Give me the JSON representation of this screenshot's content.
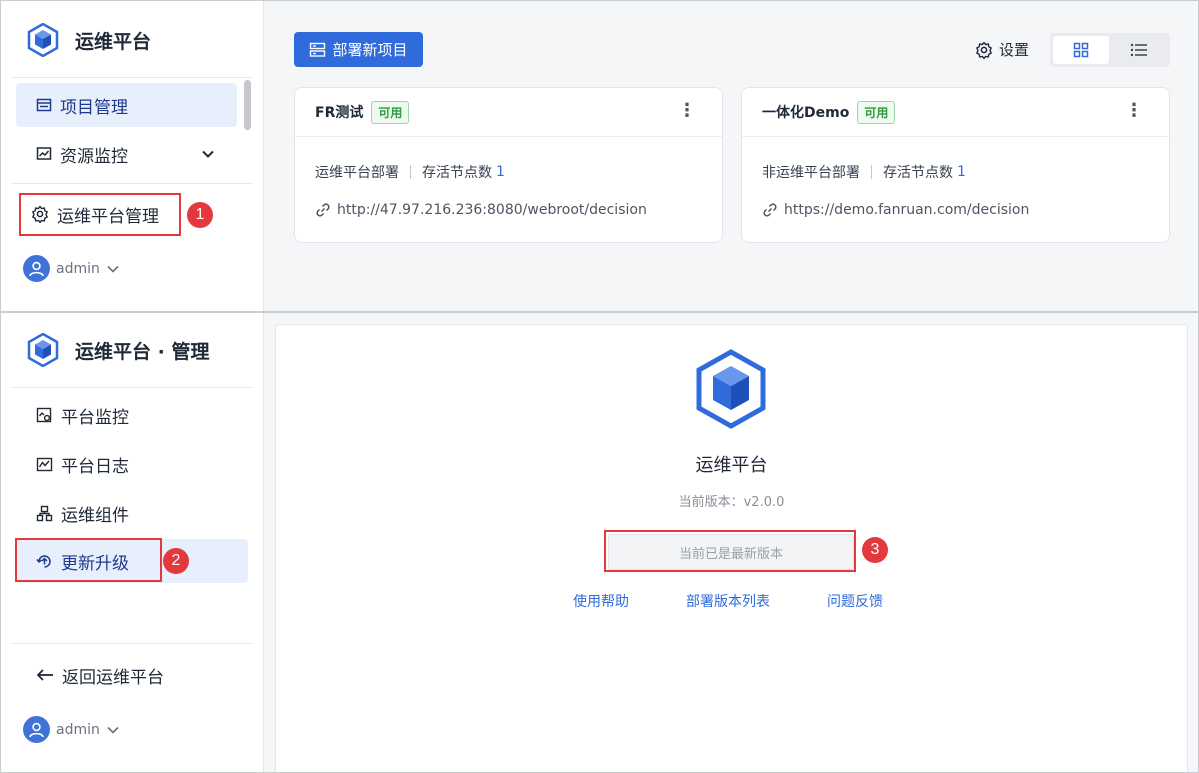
{
  "top": {
    "brand": "运维平台",
    "nav": [
      {
        "label": "项目管理",
        "active": true
      },
      {
        "label": "资源监控",
        "active": false
      }
    ],
    "manage_link": "运维平台管理",
    "user": "admin",
    "toolbar": {
      "deploy_label": "部署新项目",
      "settings_label": "设置"
    },
    "cards": [
      {
        "title": "FR测试",
        "status": "可用",
        "type": "运维平台部署",
        "nodes_label": "存活节点数",
        "nodes": "1",
        "url": "http://47.97.216.236:8080/webroot/decision"
      },
      {
        "title": "一体化Demo",
        "status": "可用",
        "type": "非运维平台部署",
        "nodes_label": "存活节点数",
        "nodes": "1",
        "url": "https://demo.fanruan.com/decision"
      }
    ]
  },
  "bottom": {
    "brand": "运维平台 · 管理",
    "nav": [
      {
        "label": "平台监控"
      },
      {
        "label": "平台日志"
      },
      {
        "label": "运维组件"
      },
      {
        "label": "更新升级",
        "active": true
      }
    ],
    "back_label": "返回运维平台",
    "user": "admin",
    "app_name": "运维平台",
    "version_text": "当前版本：v2.0.0",
    "latest_label": "当前已是最新版本",
    "links": [
      "使用帮助",
      "部署版本列表",
      "问题反馈"
    ]
  },
  "annotations": [
    "1",
    "2",
    "3"
  ],
  "colors": {
    "primary": "#2f6bdb",
    "active_bg": "#e8effc",
    "annotation": "#e3393c",
    "status_green": "#2e9d3f"
  }
}
